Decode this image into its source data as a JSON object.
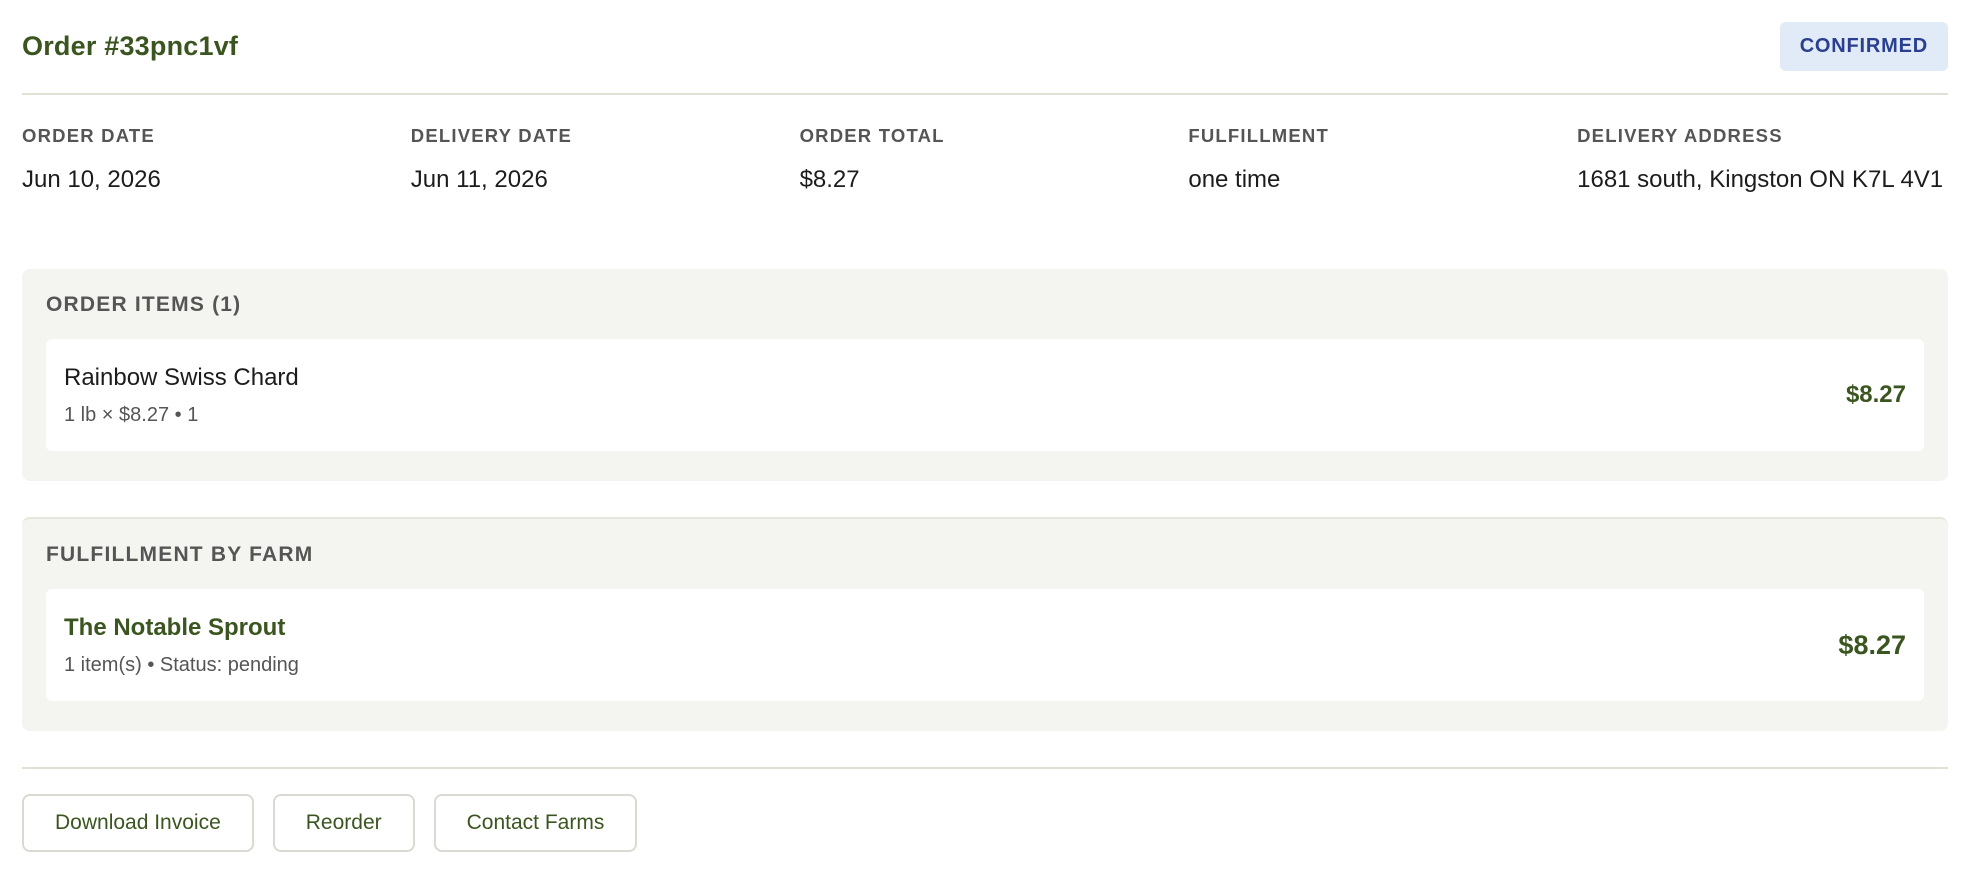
{
  "order": {
    "title": "Order #33pnc1vf",
    "status": "CONFIRMED"
  },
  "meta": [
    {
      "label": "ORDER DATE",
      "value": "Jun 10, 2026"
    },
    {
      "label": "DELIVERY DATE",
      "value": "Jun 11, 2026"
    },
    {
      "label": "ORDER TOTAL",
      "value": "$8.27"
    },
    {
      "label": "FULFILLMENT",
      "value": "one time"
    },
    {
      "label": "DELIVERY ADDRESS",
      "value": "1681 south, Kingston ON K7L 4V1"
    }
  ],
  "items_panel": {
    "title": "ORDER ITEMS (1)",
    "items": [
      {
        "name": "Rainbow Swiss Chard",
        "detail": "1 lb × $8.27 • 1",
        "price": "$8.27"
      }
    ]
  },
  "farm_panel": {
    "title": "FULFILLMENT BY FARM",
    "farms": [
      {
        "name": "The Notable Sprout",
        "detail": "1 item(s) • Status: pending",
        "price": "$8.27"
      }
    ]
  },
  "actions": {
    "download": "Download Invoice",
    "reorder": "Reorder",
    "contact": "Contact Farms"
  },
  "colors": {
    "accent": "#3b5520",
    "badge_bg": "#e1eaf7",
    "badge_text": "#2a3f8f",
    "panel_bg": "#f4f5f0"
  }
}
